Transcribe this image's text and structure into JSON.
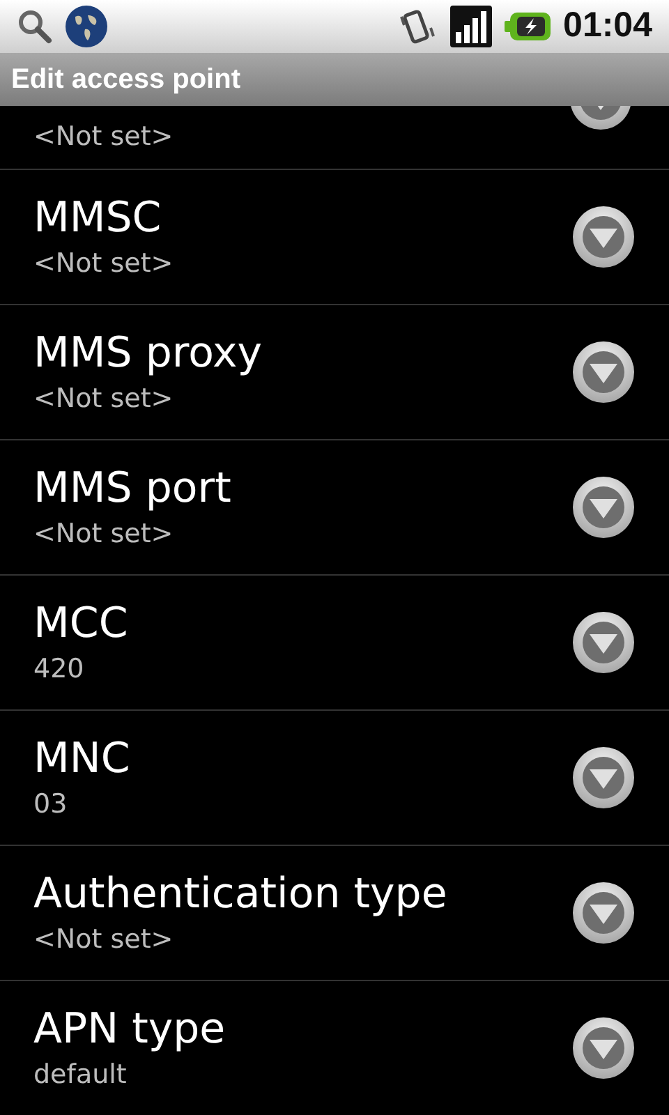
{
  "status_bar": {
    "time": "01:04"
  },
  "title_bar": {
    "title": "Edit access point"
  },
  "partial_row": {
    "value": "<Not set>"
  },
  "settings": [
    {
      "title": "MMSC",
      "value": "<Not set>"
    },
    {
      "title": "MMS proxy",
      "value": "<Not set>"
    },
    {
      "title": "MMS port",
      "value": "<Not set>"
    },
    {
      "title": "MCC",
      "value": "420"
    },
    {
      "title": "MNC",
      "value": "03"
    },
    {
      "title": "Authentication type",
      "value": "<Not set>"
    },
    {
      "title": "APN type",
      "value": "default"
    }
  ]
}
